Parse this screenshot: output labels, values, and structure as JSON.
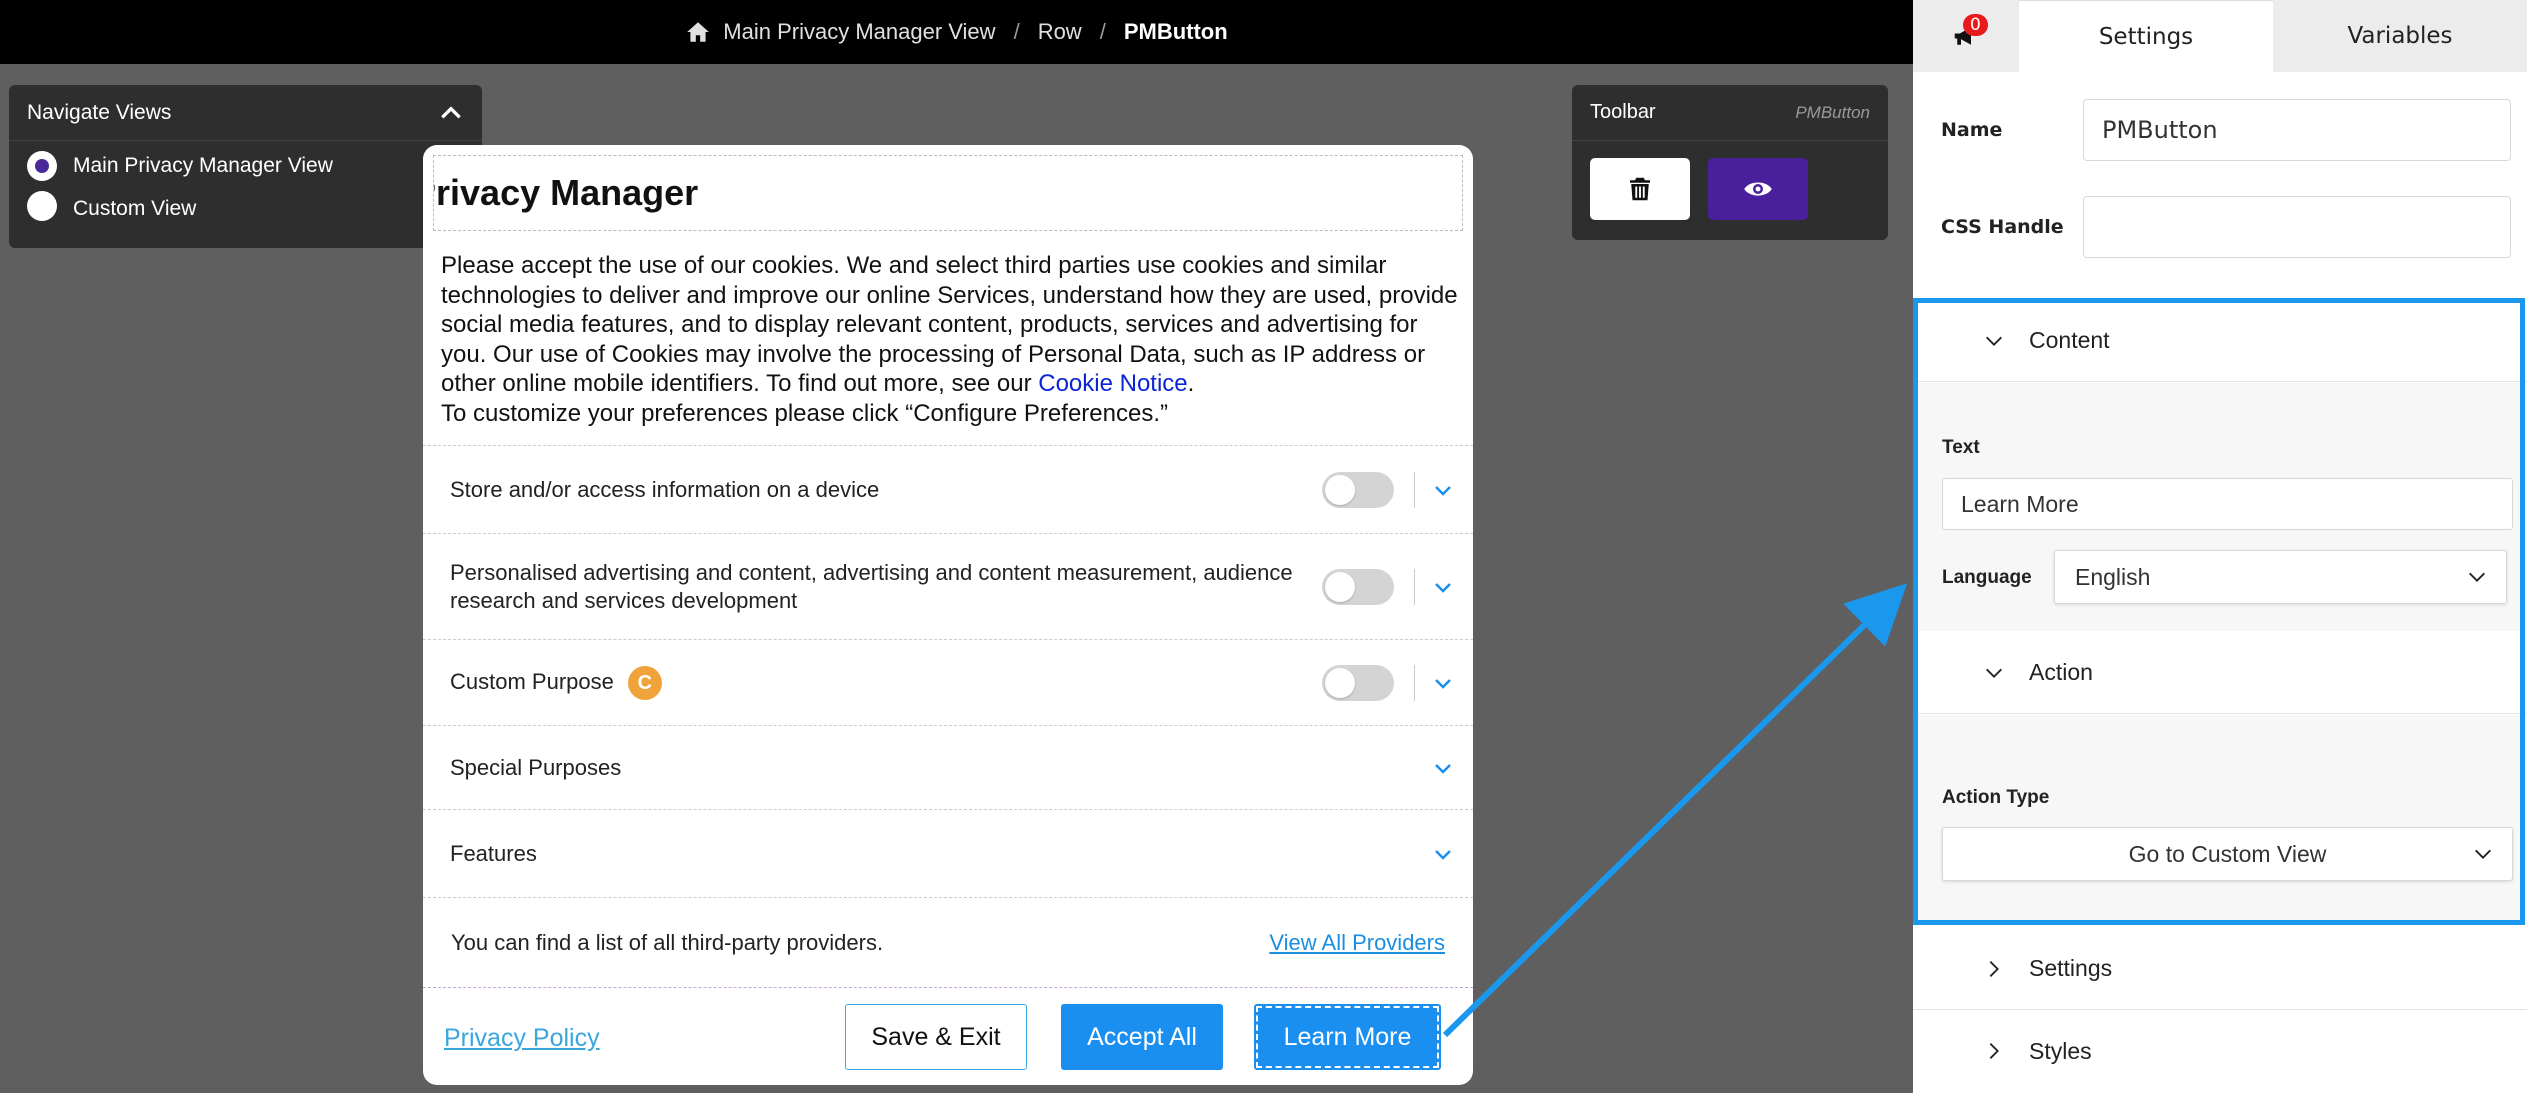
{
  "breadcrumb": {
    "items": [
      "Main Privacy Manager View",
      "Row",
      "PMButton"
    ]
  },
  "nav_views": {
    "title": "Navigate Views",
    "options": [
      "Main Privacy Manager View",
      "Custom View"
    ],
    "selected": 0
  },
  "toolbar": {
    "title": "Toolbar",
    "selected_component": "PMButton"
  },
  "modal": {
    "title": "Privacy Manager",
    "description_main": "Please accept the use of our cookies. We and select third parties use cookies and similar technologies to deliver and improve our online Services, understand how they are used, provide social media features, and to display relevant content, products, services and advertising for you. Our use of Cookies may involve the processing of Personal Data, such as IP address or other online mobile identifiers. To find out more, see our ",
    "cookie_link": "Cookie Notice",
    "description_end": ".",
    "description_line2": "To customize your preferences please click “Configure Preferences.”",
    "purposes": [
      {
        "label": "Store and/or access information on a device"
      },
      {
        "label": "Personalised advertising and content, advertising and content measurement, audience research and services development"
      },
      {
        "label": "Custom Purpose",
        "badge": "C"
      },
      {
        "label": "Special Purposes"
      },
      {
        "label": "Features"
      }
    ],
    "providers_text": "You can find a list of all third-party providers.",
    "providers_link": "View All Providers",
    "privacy_policy": "Privacy Policy",
    "btn_save": "Save & Exit",
    "btn_accept": "Accept All",
    "btn_learn": "Learn More"
  },
  "panel": {
    "notif_count": "0",
    "tab_settings": "Settings",
    "tab_variables": "Variables",
    "name_label": "Name",
    "name_value": "PMButton",
    "css_label": "CSS Handle",
    "css_value": "",
    "content_header": "Content",
    "text_label": "Text",
    "text_value": "Learn More",
    "language_label": "Language",
    "language_value": "English",
    "action_header": "Action",
    "action_type_label": "Action Type",
    "action_type_value": "Go to Custom View",
    "settings_header": "Settings",
    "styles_header": "Styles"
  },
  "colors": {
    "accent": "#1b8ff0",
    "highlight": "#1a98ee",
    "view_btn": "#4a1f9c",
    "badge": "#f0a23b"
  }
}
